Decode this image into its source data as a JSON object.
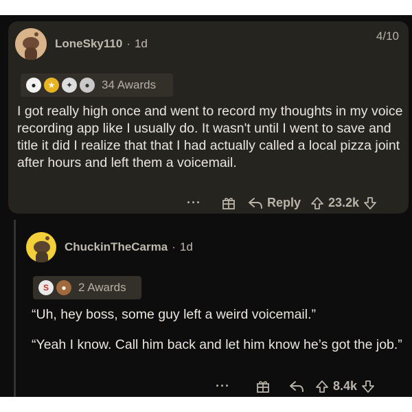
{
  "comment1": {
    "page_indicator": "4/10",
    "username": "LoneSky110",
    "separator": "·",
    "age": "1d",
    "awards_label": "34 Awards",
    "body": "I got really high once and went to record my thoughts in my voice recording app like I usually do. It wasn't until I went to save and title it did I realize that that I had actually called a local pizza joint after hours and left them a voicemail.",
    "more": "···",
    "reply_label": "Reply",
    "score": "23.2k"
  },
  "comment2": {
    "username": "ChuckinTheCarma",
    "separator": "·",
    "age": "1d",
    "awards_label": "2 Awards",
    "paragraph1": "“Uh, hey boss, some guy left a weird voicemail.”",
    "paragraph2": "“Yeah I know. Call him back and let him know he’s got the job.”",
    "more": "···",
    "score": "8.4k"
  },
  "icons": [
    "snoo-avatar",
    "award-icon",
    "gift-icon",
    "reply-arrow-icon",
    "upvote-icon",
    "downvote-icon"
  ]
}
